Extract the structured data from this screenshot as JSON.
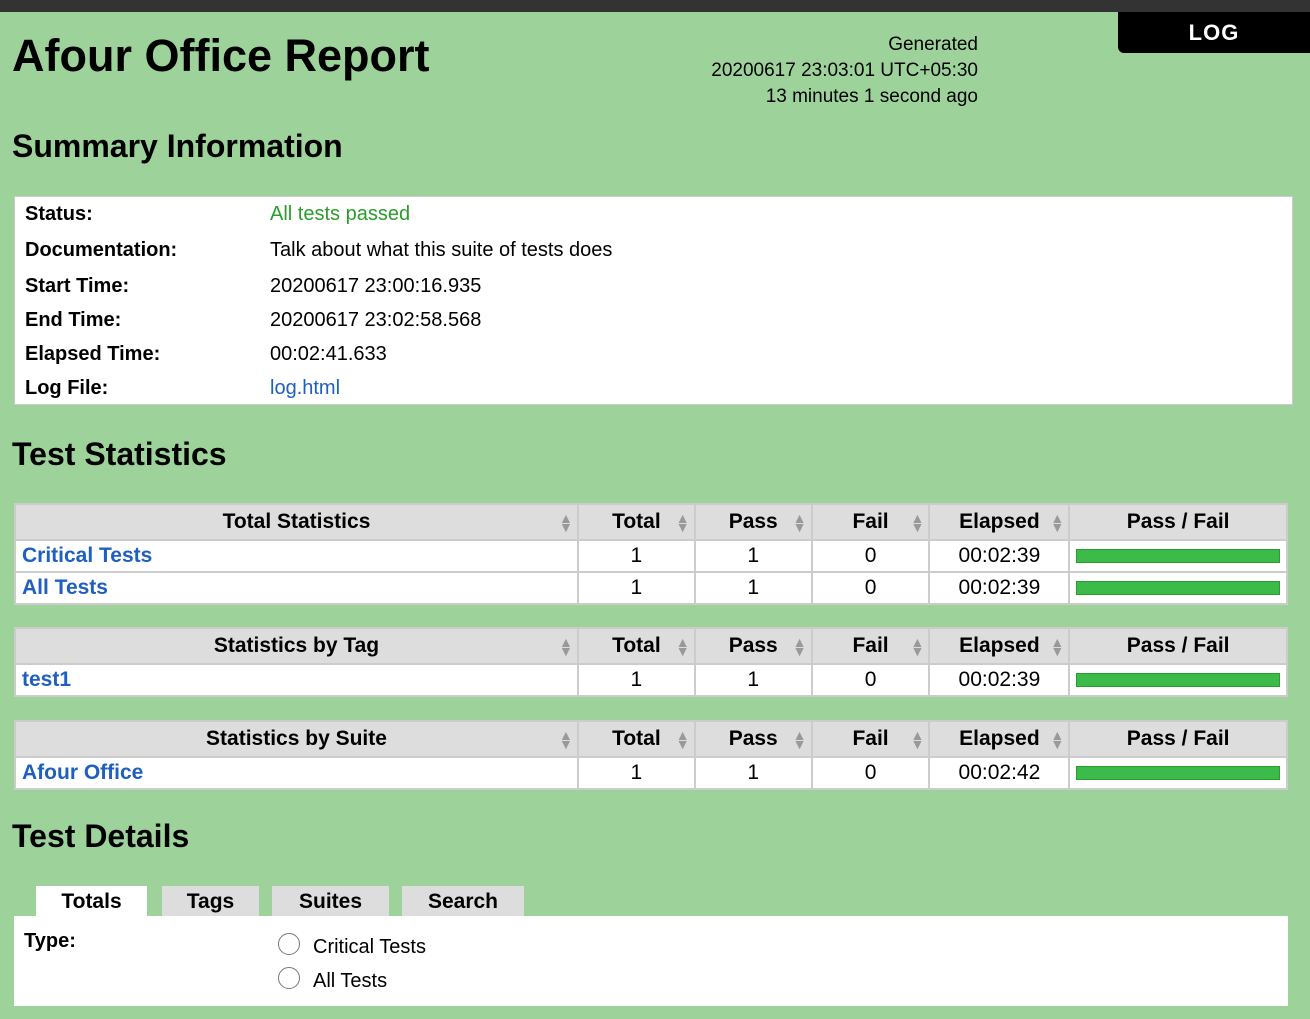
{
  "header": {
    "title": "Afour Office Report",
    "generated_label": "Generated",
    "generated_time": "20200617 23:03:01 UTC+05:30",
    "generated_ago": "13 minutes 1 second ago",
    "log_button": "LOG"
  },
  "summary": {
    "heading": "Summary Information",
    "rows": [
      {
        "label": "Status:",
        "value": "All tests passed"
      },
      {
        "label": "Documentation:",
        "value": "Talk about what this suite of tests does"
      },
      {
        "label": "Start Time:",
        "value": "20200617 23:00:16.935"
      },
      {
        "label": "End Time:",
        "value": "20200617 23:02:58.568"
      },
      {
        "label": "Elapsed Time:",
        "value": "00:02:41.633"
      },
      {
        "label": "Log File:",
        "value": "log.html"
      }
    ]
  },
  "statistics": {
    "heading": "Test Statistics",
    "columns": [
      "Total",
      "Pass",
      "Fail",
      "Elapsed",
      "Pass / Fail"
    ],
    "tables": [
      {
        "title": "Total Statistics",
        "rows": [
          {
            "name": "Critical Tests",
            "total": "1",
            "pass": "1",
            "fail": "0",
            "elapsed": "00:02:39",
            "pass_fraction": 1
          },
          {
            "name": "All Tests",
            "total": "1",
            "pass": "1",
            "fail": "0",
            "elapsed": "00:02:39",
            "pass_fraction": 1
          }
        ]
      },
      {
        "title": "Statistics by Tag",
        "rows": [
          {
            "name": "test1",
            "total": "1",
            "pass": "1",
            "fail": "0",
            "elapsed": "00:02:39",
            "pass_fraction": 1
          }
        ]
      },
      {
        "title": "Statistics by Suite",
        "rows": [
          {
            "name": "Afour Office",
            "total": "1",
            "pass": "1",
            "fail": "0",
            "elapsed": "00:02:42",
            "pass_fraction": 1
          }
        ]
      }
    ]
  },
  "details": {
    "heading": "Test Details",
    "tabs": [
      "Totals",
      "Tags",
      "Suites",
      "Search"
    ],
    "type_label": "Type:",
    "options": [
      "Critical Tests",
      "All Tests"
    ]
  },
  "colors": {
    "background": "#9dd39a",
    "pass": "#3cba4a",
    "link": "#1f5fbf"
  }
}
